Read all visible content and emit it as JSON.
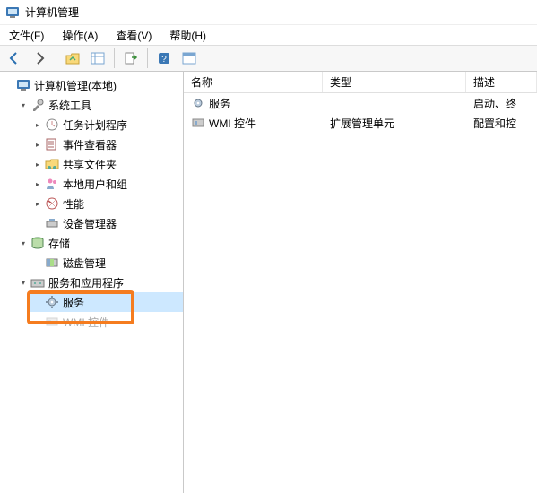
{
  "window": {
    "title": "计算机管理"
  },
  "menubar": {
    "file": "文件(F)",
    "action": "操作(A)",
    "view": "查看(V)",
    "help": "帮助(H)"
  },
  "tree": {
    "root": "计算机管理(本地)",
    "system_tools": {
      "label": "系统工具",
      "task_scheduler": "任务计划程序",
      "event_viewer": "事件查看器",
      "shared_folders": "共享文件夹",
      "local_users": "本地用户和组",
      "performance": "性能",
      "device_manager": "设备管理器"
    },
    "storage": {
      "label": "存储",
      "disk_mgmt": "磁盘管理"
    },
    "services_apps": {
      "label": "服务和应用程序",
      "services": "服务",
      "wmi": "WMI 控件"
    }
  },
  "list": {
    "columns": {
      "name": "名称",
      "type": "类型",
      "desc": "描述"
    },
    "rows": [
      {
        "name": "服务",
        "type": "",
        "desc": "启动、终"
      },
      {
        "name": "WMI 控件",
        "type": "扩展管理单元",
        "desc": "配置和控"
      }
    ]
  }
}
